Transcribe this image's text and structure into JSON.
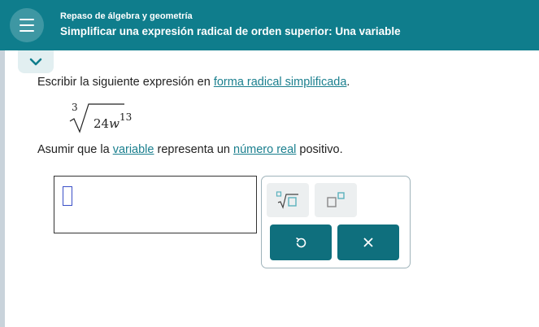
{
  "header": {
    "subtitle": "Repaso de álgebra y geometría",
    "title": "Simplificar una expresión radical de orden superior: Una variable"
  },
  "problem": {
    "instruction_prefix": "Escribir la siguiente expresión en ",
    "instruction_link": "forma radical simplificada",
    "instruction_suffix": ".",
    "radical_index": "3",
    "radicand_coefficient": "24",
    "radicand_variable": "w",
    "radicand_exponent": "13",
    "assume_prefix": "Asumir que la ",
    "assume_link1": "variable",
    "assume_middle": " representa un ",
    "assume_link2": "número real",
    "assume_suffix": " positivo."
  },
  "icons": {
    "menu": "menu-icon",
    "collapse": "chevron-down-icon",
    "nth_root": "nth-root-icon",
    "power": "superscript-icon",
    "undo": "undo-icon",
    "clear": "close-icon"
  },
  "colors": {
    "header": "#0f7d8c",
    "link": "#1a7f8e",
    "action_button": "#0f6f7d",
    "cursor": "#3a4fc7"
  }
}
